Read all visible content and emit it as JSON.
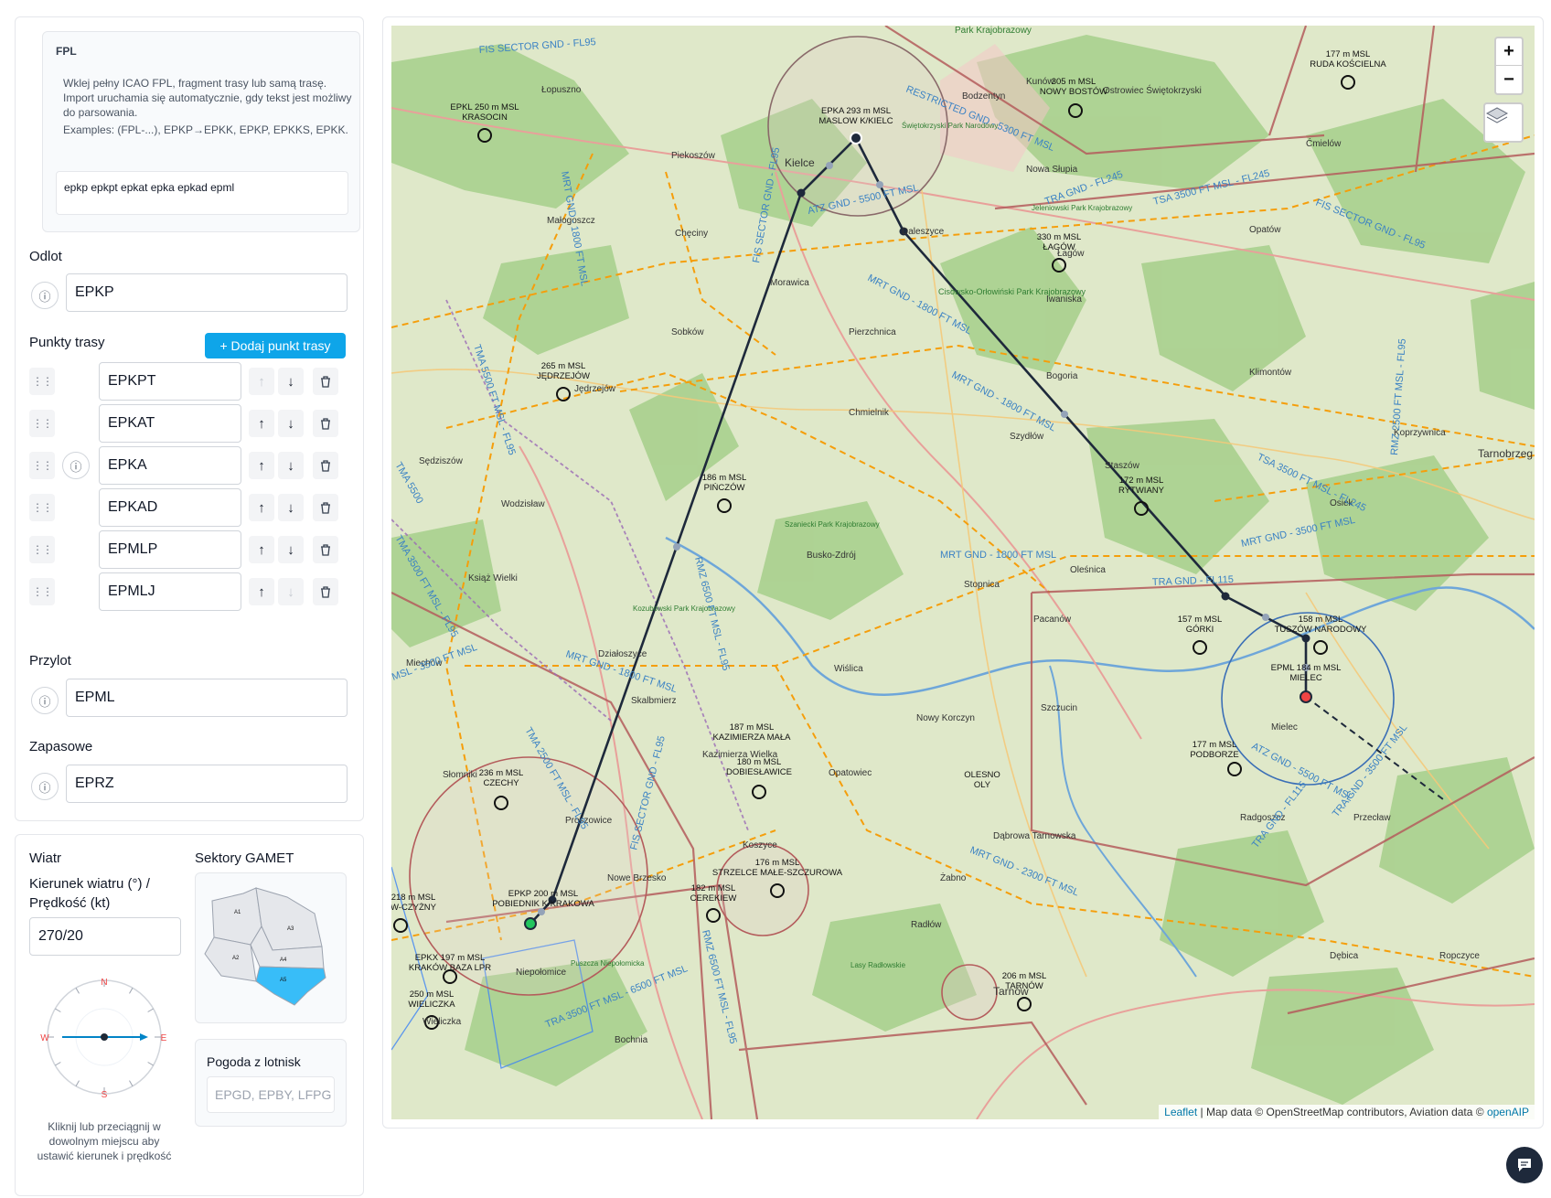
{
  "fpl": {
    "title": "FPL",
    "help_line1": "Wklej pełny ICAO FPL, fragment trasy lub samą trasę. Import uruchamia się automatycznie, gdy tekst jest możliwy do parsowania.",
    "help_line2": "Examples: (FPL-...), EPKP→EPKK, EPKP, EPKKS, EPKK.",
    "input_value": "epkp epkpt epkat epka epkad epml"
  },
  "departure": {
    "label": "Odlot",
    "value": "EPKP"
  },
  "route": {
    "label": "Punkty trasy",
    "add_button": "+ Dodaj punkt trasy",
    "waypoints": [
      {
        "code": "EPKPT",
        "has_info": false,
        "up_enabled": false,
        "down_enabled": true
      },
      {
        "code": "EPKAT",
        "has_info": false,
        "up_enabled": true,
        "down_enabled": true
      },
      {
        "code": "EPKA",
        "has_info": true,
        "up_enabled": true,
        "down_enabled": true
      },
      {
        "code": "EPKAD",
        "has_info": false,
        "up_enabled": true,
        "down_enabled": true
      },
      {
        "code": "EPMLP",
        "has_info": false,
        "up_enabled": true,
        "down_enabled": true
      },
      {
        "code": "EPMLJ",
        "has_info": false,
        "up_enabled": true,
        "down_enabled": false
      }
    ]
  },
  "arrival": {
    "label": "Przylot",
    "value": "EPML"
  },
  "alternate": {
    "label": "Zapasowe",
    "value": "EPRZ"
  },
  "wind": {
    "title": "Wiatr",
    "field_label": "Kierunek wiatru (°) / Prędkość (kt)",
    "value": "270/20",
    "compass": {
      "n": "N",
      "e": "E",
      "s": "S",
      "w": "W",
      "direction_deg": 270
    },
    "hint": "Kliknij lub przeciągnij w dowolnym miejscu aby ustawić kierunek i prędkość"
  },
  "gamet": {
    "title": "Sektory GAMET",
    "sectors": [
      "A1",
      "A2",
      "A3",
      "A4",
      "A5"
    ],
    "selected": "A5",
    "highlight_color": "#38bdf8"
  },
  "weather": {
    "title": "Pogoda z lotnisk",
    "placeholder": "EPGD, EPBY, LFPG"
  },
  "map": {
    "zoom_in": "+",
    "zoom_out": "−",
    "attribution_leaflet": "Leaflet",
    "attribution_text": " | Map data © OpenStreetMap contributors, Aviation data © ",
    "attribution_openaip": "openAIP",
    "route_color": "#1e293b",
    "airspace_orange": "#f59e0b",
    "airspace_red": "#b45c5c",
    "airports": [
      {
        "name": "EPKL 250 m MSL",
        "sub": "KRASOCIN"
      },
      {
        "name": "EPKA 293 m MSL",
        "sub": "MASLOW K/KIELC"
      },
      {
        "name": "305 m MSL",
        "sub": "NOWY BOSTÓW"
      },
      {
        "name": "177 m MSL",
        "sub": "RUDA KOŚCIELNA"
      },
      {
        "name": "330 m MSL",
        "sub": "ŁAGÓW"
      },
      {
        "name": "265 m MSL",
        "sub": "JĘDRZEJÓW"
      },
      {
        "name": "186 m MSL",
        "sub": "PIŃCZÓW"
      },
      {
        "name": "172 m MSL",
        "sub": "RYTWIANY"
      },
      {
        "name": "157 m MSL",
        "sub": "GÓRKI"
      },
      {
        "name": "158 m MSL",
        "sub": "TUSZÓW NARODOWY"
      },
      {
        "name": "EPML 184 m MSL",
        "sub": "MIELEC"
      },
      {
        "name": "177 m MSL",
        "sub": "PODBORZE"
      },
      {
        "name": "187 m MSL",
        "sub": "KAZIMIERZA MAŁA"
      },
      {
        "name": "180 m MSL",
        "sub": "DOBIESŁAWICE"
      },
      {
        "name": "236 m MSL",
        "sub": "CZECHY"
      },
      {
        "name": "OLESNO",
        "sub": "OLY"
      },
      {
        "name": "176 m MSL",
        "sub": "STRZELCE MAŁE-SZCZUROWA"
      },
      {
        "name": "182 m MSL",
        "sub": "CEREKIEW"
      },
      {
        "name": "EPKP 200 m MSL",
        "sub": "POBIEDNIK K/KRAKOWA"
      },
      {
        "name": "218 m MSL",
        "sub": "W-CZYŻNY"
      },
      {
        "name": "EPKX 197 m MSL",
        "sub": "KRAKÓW BAZA LPR"
      },
      {
        "name": "250 m MSL",
        "sub": "WIELICZKA"
      },
      {
        "name": "206 m MSL",
        "sub": "TARNÓW"
      }
    ],
    "places": [
      "Park Krajobrazowy",
      "Łopuszno",
      "Piekoszów",
      "Kielce",
      "Małogoszcz",
      "Chęciny",
      "Morawica",
      "Sobków",
      "Pierzchnica",
      "Jędrzejów",
      "Chmielnik",
      "Szydłów",
      "Bogoria",
      "Staszów",
      "Klimontów",
      "Iwaniska",
      "Opatów",
      "Ćmielów",
      "Kunów",
      "Ostrowiec Świętokrzyski",
      "Bodzentyn",
      "Nowa Słupia",
      "Daleszyce",
      "Łagów",
      "Sędziszów",
      "Wodzisław",
      "Książ Wielki",
      "Busko-Zdrój",
      "Stopnica",
      "Oleśnica",
      "Pacanów",
      "Osiek",
      "Koprzywnica",
      "Tarnobrzeg",
      "Miechów",
      "Działoszyce",
      "Skalbmierz",
      "Wiślica",
      "Nowy Korczyn",
      "Szczucin",
      "Kazimierza Wielka",
      "Opatowiec",
      "Słomniki",
      "Proszowice",
      "Koszyce",
      "Nowe Brzesko",
      "Dąbrowa Tarnowska",
      "Żabno",
      "Radgoszcz",
      "Mielec",
      "Przecław",
      "Niepołomice",
      "Radłów",
      "Tarnów",
      "Dębica",
      "Ropczyce",
      "Wieliczka",
      "Bochnia",
      "Cisowsko-Orłowiński Park Krajobrazowy",
      "Świętokrzyski Park Narodowy",
      "Jeleniowski Park Krajobrazowy",
      "Szaniecki Park Krajobrazowy",
      "Kozubowski Park Krajobrazowy",
      "Puszcza Niepołomicka",
      "Lasy Radłowskie"
    ],
    "airspace_labels": [
      "FIS SECTOR GND - FL95",
      "MRT GND - 1800 FT MSL",
      "FIS SECTOR GND - FL95",
      "RESTRICTED GND - 5300 FT MSL",
      "TRA GND - FL245",
      "TSA 3500 FT MSL - FL245",
      "FIS SECTOR GND - FL95",
      "ATZ GND - 5500 FT MSL",
      "MRT GND - 1800 FT MSL",
      "TMA 5500 FT MSL - FL95",
      "MRT GND - 1800 FT MSL",
      "TSA 3500 FT MSL - FL245",
      "MRT GND - 3500 FT MSL",
      "TRA GND - FL115",
      "MRT GND - 1800 FT MSL",
      "RMZ 6500 FT MSL - FL95",
      "MRT GND - 1800 FT MSL",
      "TMA 2500 FT MSL - FL95",
      "FIS SECTOR GND - FL95",
      "MRT GND - 2300 FT MSL",
      "RMZ 6500 FT MSL - FL95",
      "TRA 3500 FT MSL - 6500 FT MSL",
      "TRA GND - FL115",
      "TRA GND - 3500 FT MSL",
      "RMZ 2500 FT MSL - FL95",
      "TMA 3500 FT MSL - FL95",
      "TMA 5500",
      "MSL - 3500 FT MSL",
      "ATZ GND - 5500 FT MSL"
    ]
  }
}
